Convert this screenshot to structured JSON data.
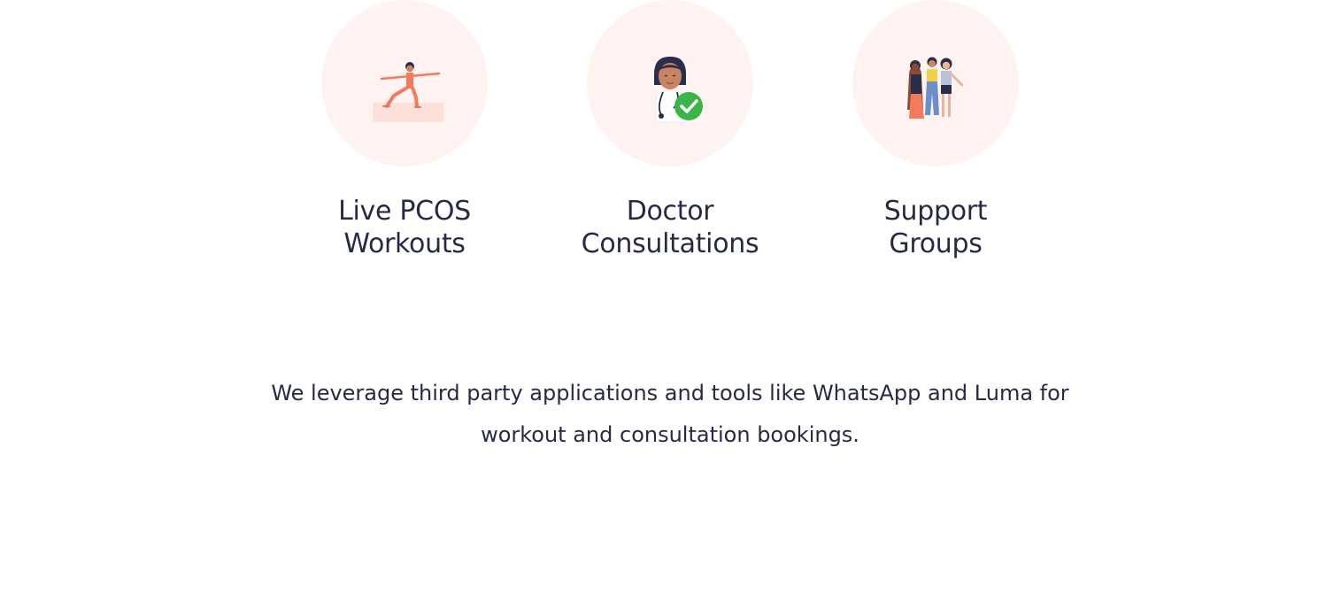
{
  "features": [
    {
      "icon": "yoga-warrior-pose-icon",
      "label": "Live PCOS\nWorkouts"
    },
    {
      "icon": "doctor-verified-icon",
      "label": "Doctor\nConsultations"
    },
    {
      "icon": "women-group-icon",
      "label": "Support\nGroups"
    }
  ],
  "disclaimer": "We leverage third party applications and tools like WhatsApp and Luma for workout and consultation bookings.",
  "colors": {
    "circle_bg": "#fff3f2",
    "text": "#262b45",
    "accent_coral": "#f27a5e",
    "check_green": "#3bb54a"
  }
}
